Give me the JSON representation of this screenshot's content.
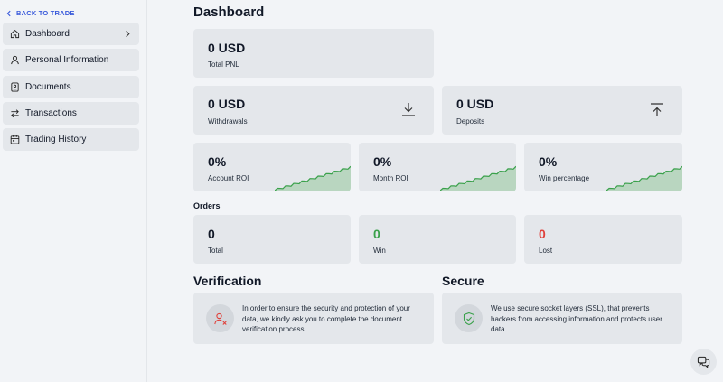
{
  "sidebar": {
    "back_label": "BACK TO TRADE",
    "items": [
      {
        "label": "Dashboard",
        "icon": "home-icon"
      },
      {
        "label": "Personal Information",
        "icon": "user-icon"
      },
      {
        "label": "Documents",
        "icon": "document-icon"
      },
      {
        "label": "Transactions",
        "icon": "transfer-icon"
      },
      {
        "label": "Trading History",
        "icon": "calendar-icon"
      }
    ]
  },
  "main": {
    "title": "Dashboard",
    "total_pnl": {
      "value": "0 USD",
      "label": "Total PNL"
    },
    "withdrawals": {
      "value": "0 USD",
      "label": "Withdrawals",
      "icon": "download-icon"
    },
    "deposits": {
      "value": "0 USD",
      "label": "Deposits",
      "icon": "upload-icon"
    },
    "stats": [
      {
        "value": "0%",
        "label": "Account ROI"
      },
      {
        "value": "0%",
        "label": "Month ROI"
      },
      {
        "value": "0%",
        "label": "Win percentage"
      }
    ],
    "orders_heading": "Orders",
    "orders": [
      {
        "value": "0",
        "label": "Total",
        "color": "#111827"
      },
      {
        "value": "0",
        "label": "Win",
        "color": "#3aa14b"
      },
      {
        "value": "0",
        "label": "Lost",
        "color": "#e0413b"
      }
    ],
    "verification": {
      "heading": "Verification",
      "text": "In order to ensure the security and protection of your data, we kindly ask you to complete the document verification process",
      "icon": "user-x-icon"
    },
    "secure": {
      "heading": "Secure",
      "text": "We use secure socket layers (SSL), that prevents hackers from accessing information and protects user data.",
      "icon": "shield-check-icon"
    }
  },
  "colors": {
    "accent": "#3b5bdb",
    "win": "#3aa14b",
    "loss": "#e0413b",
    "card": "#e4e7eb",
    "spark": "#3aa14b"
  },
  "chat_icon": "chat-icon"
}
